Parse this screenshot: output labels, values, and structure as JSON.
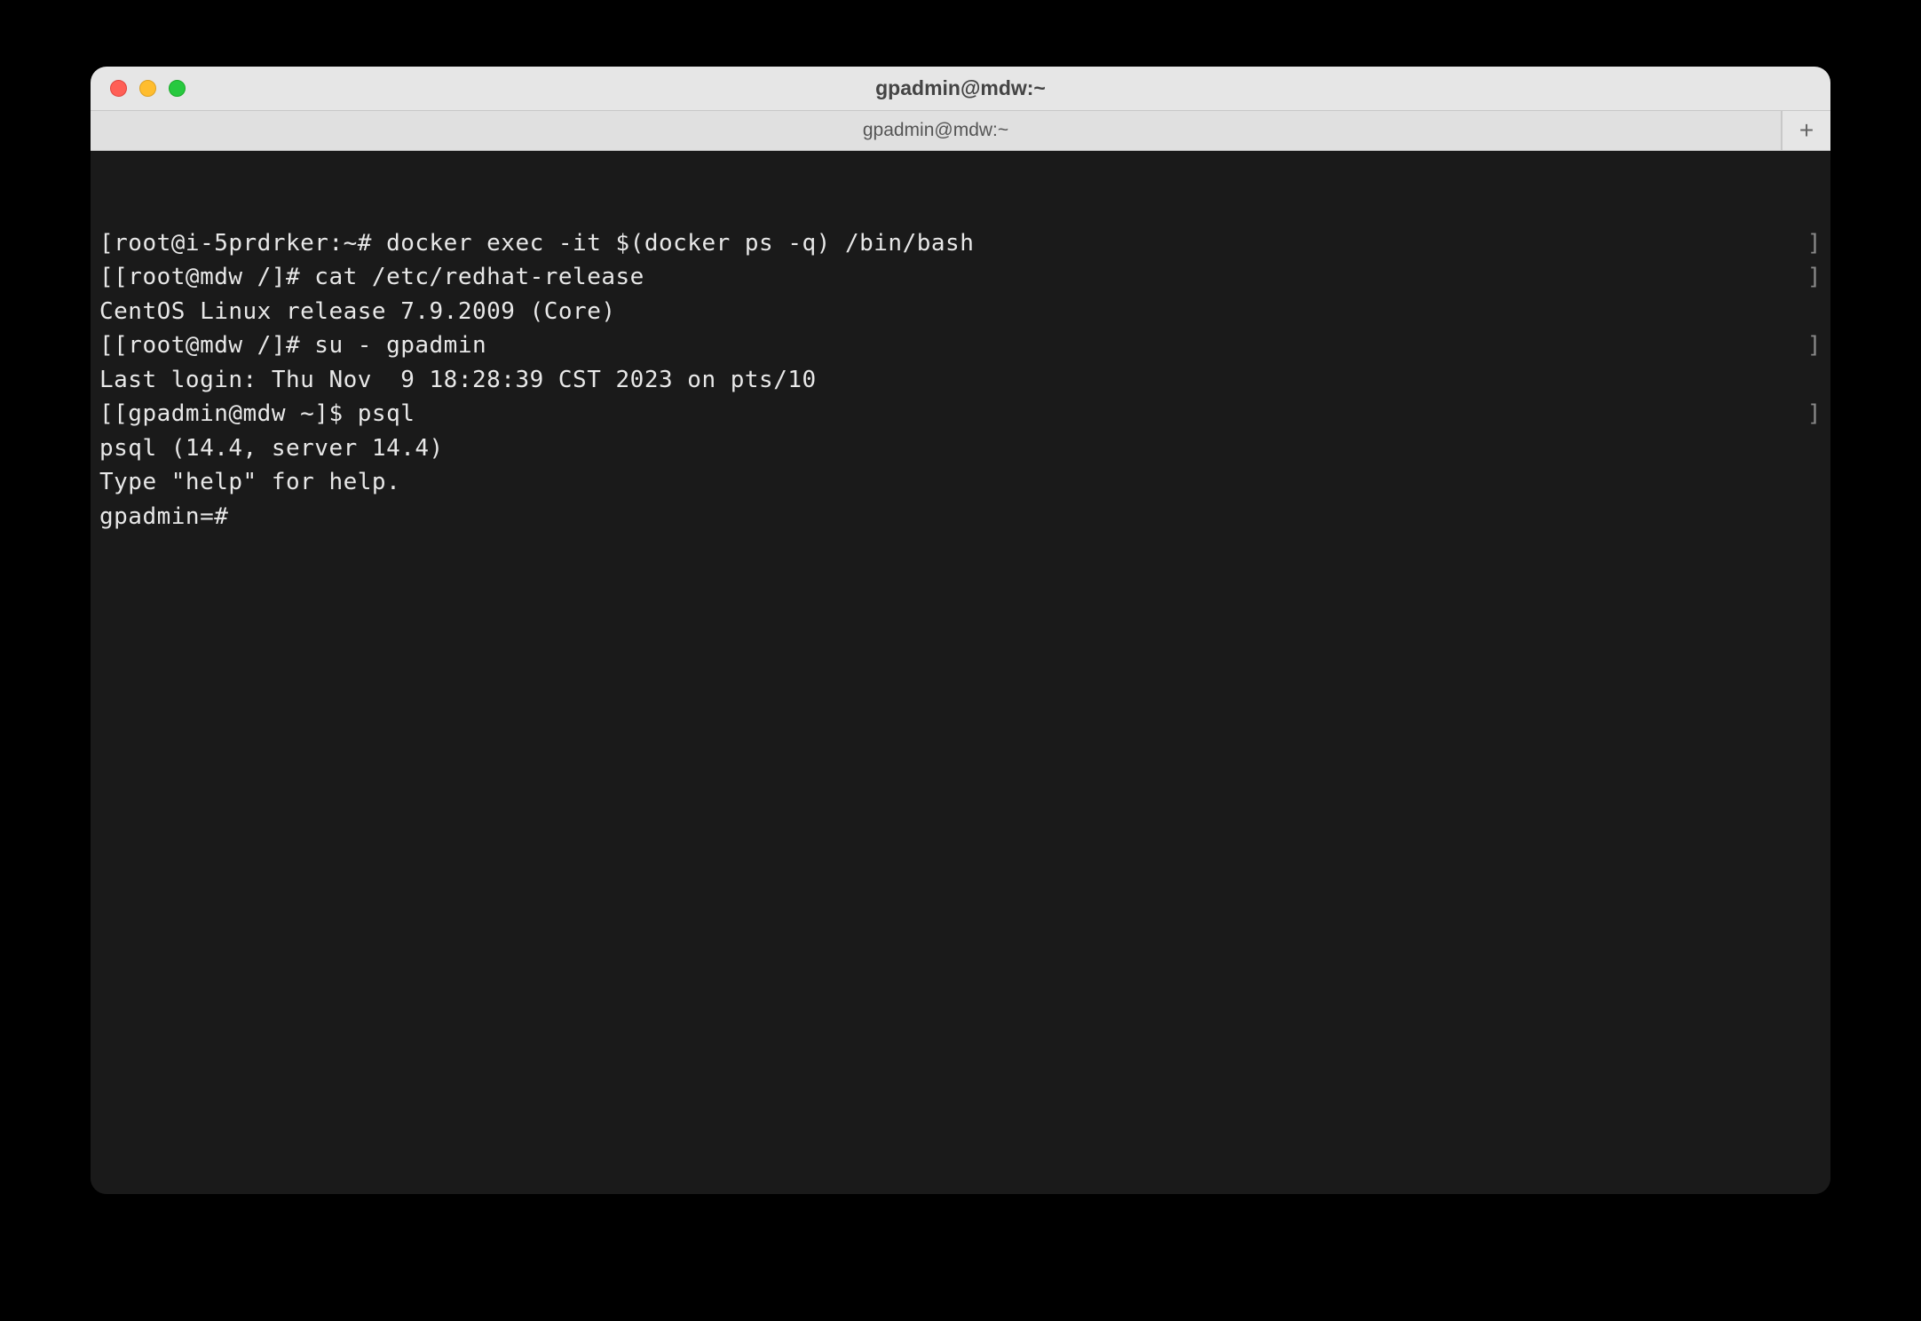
{
  "window": {
    "title": "gpadmin@mdw:~"
  },
  "tab": {
    "label": "gpadmin@mdw:~"
  },
  "terminal": {
    "lines": [
      {
        "left": "[root@i-5prdrker:~# docker exec -it $(docker ps -q) /bin/bash",
        "right": "]"
      },
      {
        "left": "[[root@mdw /]# cat /etc/redhat-release",
        "right": "]"
      },
      {
        "left": "CentOS Linux release 7.9.2009 (Core)",
        "right": ""
      },
      {
        "left": "[[root@mdw /]# su - gpadmin",
        "right": "]"
      },
      {
        "left": "Last login: Thu Nov  9 18:28:39 CST 2023 on pts/10",
        "right": ""
      },
      {
        "left": "[[gpadmin@mdw ~]$ psql",
        "right": "]"
      },
      {
        "left": "psql (14.4, server 14.4)",
        "right": ""
      },
      {
        "left": "Type \"help\" for help.",
        "right": ""
      },
      {
        "left": "",
        "right": ""
      },
      {
        "left": "gpadmin=#",
        "right": ""
      }
    ]
  },
  "icons": {
    "plus": "+"
  }
}
